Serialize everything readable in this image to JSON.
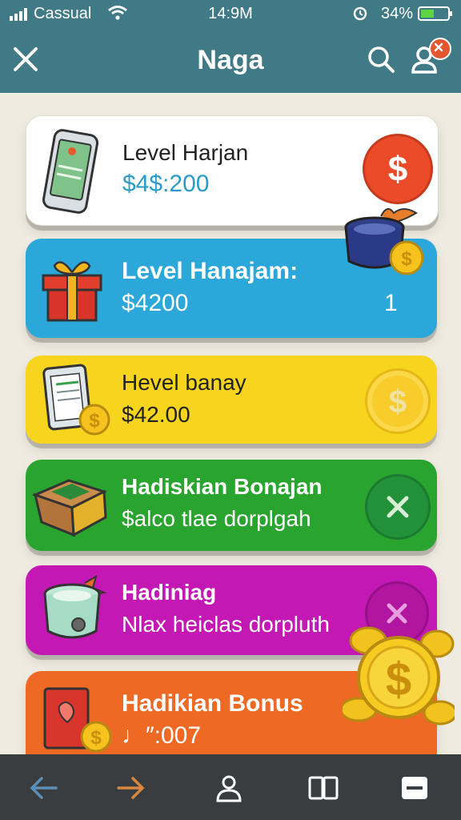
{
  "status_bar": {
    "carrier": "Cassual",
    "time": "14:9M",
    "battery": "34%"
  },
  "header": {
    "title": "Naga",
    "color": "#3f7a86"
  },
  "cards": [
    {
      "title": "Level Harjan",
      "amount": "$4$:200",
      "color": "#ffffff"
    },
    {
      "title": "Level Hanajam:",
      "amount": "$4200",
      "count": "1",
      "color": "#2ba7d9"
    },
    {
      "title": "Hevel banay",
      "amount": "$42.00",
      "color": "#f7d51f"
    },
    {
      "title": "Hadiskian Bonajan",
      "subtitle": "$alco tlae dorplgah",
      "color": "#29a52f"
    },
    {
      "title": "Hadiniag",
      "subtitle": "Nlax heiclas dorpluth",
      "color": "#c318b3"
    },
    {
      "title": "Hadikian Bonus",
      "subtitle": "♩″:007",
      "color": "#ee6a24"
    }
  ],
  "icons": {
    "header": [
      "close-icon",
      "search-icon",
      "profile-icon"
    ],
    "bottom_nav": [
      "back-arrow-icon",
      "forward-arrow-icon",
      "profile-icon",
      "book-icon",
      "menu-icon"
    ]
  }
}
